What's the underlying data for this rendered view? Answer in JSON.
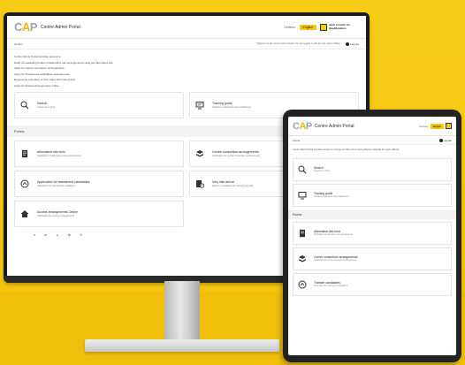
{
  "app": {
    "logo_prefix": "C",
    "logo_accent": "A",
    "logo_suffix": "P",
    "title": "Centre Admin Portal"
  },
  "header": {
    "link": "Centres",
    "button": "English",
    "badge_text": "Joint Council for Qualifications"
  },
  "userbar": {
    "user": "Centre",
    "info": "Welcome to the Centre Admin Portal. You are logged in with the role: Exam Officer",
    "logout": "Log out"
  },
  "intro": {
    "lines": [
      "Centre Admin Portal provides access to:",
      "Notify the awarding bodies of alternative site arrangements using the Alternative site.",
      "Apply for Centre consortium arrangements.",
      "Apply for Transferred candidates arrangements.",
      "Request an extension of time using Very late arrival.",
      "Apply for Access arrangements online."
    ]
  },
  "top_cards": [
    {
      "title": "Search",
      "desc": "Search for a form",
      "icon": "search-icon"
    },
    {
      "title": "Training guide",
      "desc": "Guidance material to help practitioners",
      "icon": "training-guide-icon"
    }
  ],
  "forms_section": "Forms",
  "form_cards": [
    {
      "title": "Alternative site form",
      "desc": "Notification of alternative site arrangements",
      "icon": "document-icon"
    },
    {
      "title": "Centre consortium arrangements",
      "desc": "Application for centre consortium arrangements",
      "icon": "consortium-icon"
    },
    {
      "title": "Application for transferred candidates",
      "desc": "Application for transferred candidates",
      "icon": "transfer-icon"
    },
    {
      "title": "Very late arrival",
      "desc": "Report a candidate who arrived very late",
      "icon": "late-arrival-icon"
    },
    {
      "title": "Access arrangements Online",
      "desc": "Application for access arrangements",
      "icon": "home-icon"
    }
  ],
  "tablet": {
    "intro": "Centre Admin Portal provides access to a range of online forms and guidance materials for exam officers.",
    "cards": [
      {
        "title": "Search",
        "desc": "Search for a form",
        "icon": "search-icon"
      },
      {
        "title": "Training guide",
        "desc": "Guidance material to help practitioners",
        "icon": "training-guide-icon"
      }
    ],
    "forms_section": "Forms",
    "form_cards": [
      {
        "title": "Alternative site form",
        "desc": "Notification of alternative site arrangements",
        "icon": "document-icon"
      },
      {
        "title": "Centre consortium arrangements",
        "desc": "Application for centre consortium arrangements",
        "icon": "consortium-icon"
      },
      {
        "title": "Transfer candidates",
        "desc": "Application for transferred candidates",
        "icon": "transfer-icon"
      }
    ]
  },
  "colors": {
    "brand_yellow": "#f6c711",
    "logo_grey": "#9aa3b4"
  }
}
